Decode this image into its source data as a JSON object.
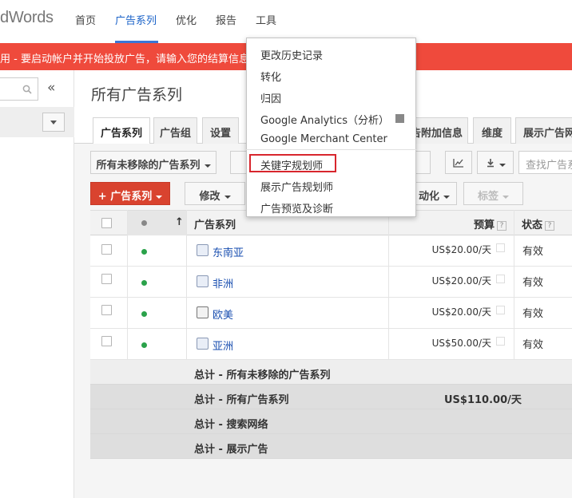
{
  "topbar": {
    "logo": "dWords",
    "nav": [
      "首页",
      "广告系列",
      "优化",
      "报告",
      "工具"
    ],
    "active_index": 1
  },
  "banner": {
    "text": "用 - 要启动帐户并开始投放广告，请输入您的结算信息"
  },
  "sidebar": {
    "search_icon": "search-icon",
    "collapse_label": "«",
    "dropdown_icon": "chevron-down-icon"
  },
  "main": {
    "title": "所有广告系列",
    "tabs": [
      "广告系列",
      "广告组",
      "设置",
      "告附加信息",
      "维度",
      "展示广告网"
    ],
    "active_tab": 0,
    "filter_label": "所有未移除的广告系列",
    "search_placeholder": "查找广告系",
    "buttons": {
      "add": "+ 广告系列",
      "edit": "修改",
      "automate": "动化",
      "labels": "标签"
    }
  },
  "table": {
    "headers": {
      "campaign": "广告系列",
      "budget": "预算",
      "status": "状态",
      "help": "?",
      "sort": "↑"
    },
    "rows": [
      {
        "name": "东南亚",
        "icon": "search-campaign-icon",
        "budget": "US$20.00/天",
        "status": "有效"
      },
      {
        "name": "非洲",
        "icon": "search-campaign-icon",
        "budget": "US$20.00/天",
        "status": "有效"
      },
      {
        "name": "欧美",
        "icon": "display-campaign-icon",
        "budget": "US$20.00/天",
        "status": "有效"
      },
      {
        "name": "亚洲",
        "icon": "search-campaign-icon",
        "budget": "US$50.00/天",
        "status": "有效"
      }
    ],
    "totals": [
      {
        "label": "总计 - 所有未移除的广告系列",
        "budget": ""
      },
      {
        "label": "总计 - 所有广告系列",
        "budget": "US$110.00/天"
      },
      {
        "label": "总计 - 搜索网络",
        "budget": ""
      },
      {
        "label": "总计 - 展示广告",
        "budget": ""
      }
    ]
  },
  "menu": {
    "items": [
      "更改历史记录",
      "转化",
      "归因",
      "Google Analytics（分析）",
      "Google Merchant Center",
      "关键字规划师",
      "展示广告规划师",
      "广告预览及诊断"
    ],
    "highlighted": "关键字规划师"
  },
  "colors": {
    "accent": "#1a62c8",
    "banner": "#ef4a3c",
    "add_button": "#d9432f",
    "status_green": "#2aa24a",
    "highlight_border": "#d8262d"
  }
}
